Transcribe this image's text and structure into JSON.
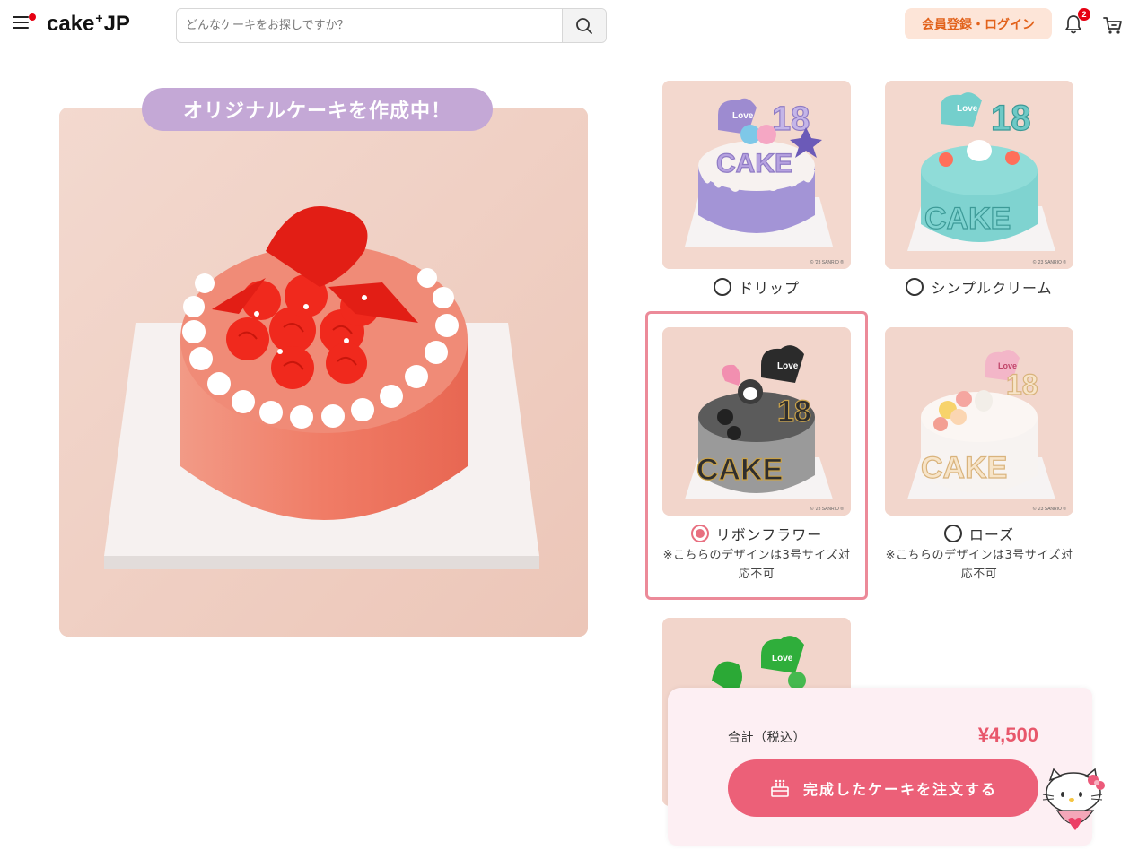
{
  "header": {
    "logo": "cake JP",
    "logo_left": "cake",
    "logo_right": "JP",
    "search_placeholder": "どんなケーキをお探しですか？",
    "login_label": "会員登録・ログイン",
    "notification_count": "2"
  },
  "main": {
    "banner": "オリジナルケーキを作成中！"
  },
  "designs": [
    {
      "label": "ドリップ",
      "selected": false,
      "note": ""
    },
    {
      "label": "シンプルクリーム",
      "selected": false,
      "note": ""
    },
    {
      "label": "リボンフラワー",
      "selected": true,
      "note": "※こちらのデザインは3号サイズ対応不可"
    },
    {
      "label": "ローズ",
      "selected": false,
      "note": "※こちらのデザインは3号サイズ対応不可"
    },
    {
      "label": "",
      "selected": false,
      "note": ""
    }
  ],
  "thumb_copyright": "© '23 SANRIO ®",
  "order": {
    "total_label": "合計（税込）",
    "total_price": "¥4,500",
    "order_button": "完成したケーキを注文する"
  },
  "colors": {
    "accent": "#ec6078",
    "price": "#e8576b",
    "login_bg": "#fde5d8",
    "login_text": "#e2621b",
    "banner_bg": "#c4a8d6"
  }
}
